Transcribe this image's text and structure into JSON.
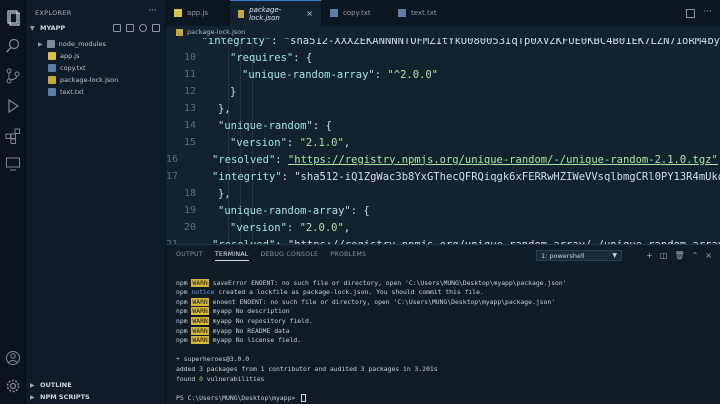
{
  "explorer": {
    "title": "EXPLORER",
    "more": "···",
    "folder": "MYAPP",
    "files": [
      {
        "name": "node_modules",
        "type": "folder"
      },
      {
        "name": "app.js",
        "type": "js"
      },
      {
        "name": "copy.txt",
        "type": "txt"
      },
      {
        "name": "package-lock.json",
        "type": "json"
      },
      {
        "name": "text.txt",
        "type": "txt"
      }
    ],
    "outline": "OUTLINE",
    "npm_scripts": "NPM SCRIPTS"
  },
  "tabs": [
    {
      "label": "app.js",
      "icon": "js-file-icon"
    },
    {
      "label": "package-lock.json",
      "icon": "json-file-icon"
    },
    {
      "label": "copy.txt",
      "icon": "text-file-icon"
    },
    {
      "label": "text.txt",
      "icon": "text-file-icon"
    }
  ],
  "breadcrumb": "package-lock.json",
  "editor": {
    "lines": [
      {
        "n": "",
        "text": "\"integrity\": \"sha512-XXXZEKANNNNTOFMZ1tYkU080053IqTp0XVZKFUE0KBC4B01EK7LZN71oRM4by"
      },
      {
        "n": "10",
        "text": "\"requires\": {"
      },
      {
        "n": "11",
        "text": "\"unique-random-array\": \"^2.0.0\""
      },
      {
        "n": "12",
        "text": "}"
      },
      {
        "n": "13",
        "text": "},"
      },
      {
        "n": "14",
        "text": "\"unique-random\": {"
      },
      {
        "n": "15",
        "text": "\"version\": \"2.1.0\","
      },
      {
        "n": "16",
        "text": "\"resolved\": \"https://registry.npmjs.org/unique-random/-/unique-random-2.1.0.tgz\","
      },
      {
        "n": "17",
        "text": "\"integrity\": \"sha512-iQ1ZgWac3b8YxGThecQFRQiqgk6xFERRwHZIWeVVsqlbmgCRl0PY13R4mUko"
      },
      {
        "n": "18",
        "text": "},"
      },
      {
        "n": "19",
        "text": "\"unique-random-array\": {"
      },
      {
        "n": "20",
        "text": "\"version\": \"2.0.0\","
      },
      {
        "n": "21",
        "text": "\"resolved\": \"https://registry.npmjs.org/unique-random-array/-/unique-random-array"
      },
      {
        "n": "22",
        "text": "\"integrity\": \"sha512-xR87O95fZ7hljw84J8r1YDXrvffPLWN513BNOP4Bv0KcgG5dyEUrHwsvP7mV"
      }
    ]
  },
  "panel": {
    "tabs": [
      "OUTPUT",
      "TERMINAL",
      "DEBUG CONSOLE",
      "PROBLEMS"
    ],
    "shell": "1: powershell",
    "terminal": [
      {
        "pre": "npm ",
        "tag": "WARN",
        "kind": "warn",
        "post": " saveError ENOENT: no such file or directory, open 'C:\\Users\\MUNG\\Desktop\\myapp\\package.json'"
      },
      {
        "pre": "npm ",
        "tag": "notice",
        "kind": "notice",
        "post": " created a lockfile as package-lock.json. You should commit this file."
      },
      {
        "pre": "npm ",
        "tag": "WARN",
        "kind": "warn",
        "post": " enoent ENOENT: no such file or directory, open 'C:\\Users\\MUNG\\Desktop\\myapp\\package.json'"
      },
      {
        "pre": "npm ",
        "tag": "WARN",
        "kind": "warn",
        "post": " myapp No description"
      },
      {
        "pre": "npm ",
        "tag": "WARN",
        "kind": "warn",
        "post": " myapp No repository field."
      },
      {
        "pre": "npm ",
        "tag": "WARN",
        "kind": "warn",
        "post": " myapp No README data"
      },
      {
        "pre": "npm ",
        "tag": "WARN",
        "kind": "warn",
        "post": " myapp No license field."
      },
      {
        "pre": "",
        "tag": "",
        "kind": "",
        "post": ""
      },
      {
        "pre": "+ superheroes@3.0.0",
        "tag": "",
        "kind": "",
        "post": ""
      },
      {
        "pre": "added 3 packages from 1 contributor and audited 3 packages in 3.201s",
        "tag": "",
        "kind": "",
        "post": ""
      },
      {
        "pre": "found ",
        "tag": "0",
        "kind": "ok",
        "post": " vulnerabilities"
      },
      {
        "pre": "",
        "tag": "",
        "kind": "",
        "post": ""
      },
      {
        "pre": "PS C:\\Users\\MUNG\\Desktop\\myapp> ",
        "tag": "",
        "kind": "",
        "post": ""
      }
    ]
  },
  "colors": {
    "accent": "#3a7bd5",
    "warn_bg": "#d7b73a",
    "string": "#a8e6a0",
    "key": "#9fe3ea"
  }
}
